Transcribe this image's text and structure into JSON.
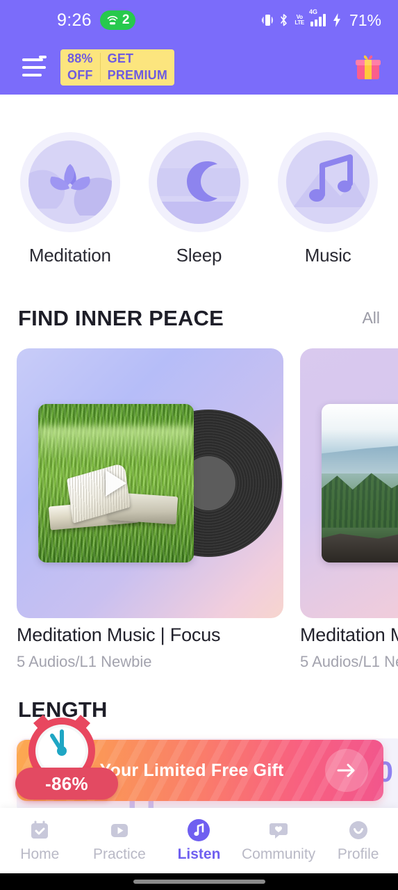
{
  "status_bar": {
    "time": "9:26",
    "hotspot_count": "2",
    "battery": "71%",
    "volte_top": "Vo",
    "volte_bottom": "LTE",
    "network": "4G",
    "icons": [
      "vibrate-icon",
      "bluetooth-icon",
      "volte-icon",
      "signal-bars-icon",
      "charging-bolt-icon"
    ]
  },
  "app_header": {
    "menu_icon": "hamburger-menu-icon",
    "has_notification_dot": true,
    "promo_discount": "88%",
    "promo_discount_line2": "OFF",
    "promo_action": "GET",
    "promo_action_line2": "PREMIUM",
    "gift_icon": "gift-box-icon",
    "background_color": "#7B6CFA",
    "promo_background": "#FCE57E",
    "promo_text_color": "#6E5BE0"
  },
  "categories": [
    {
      "label": "Meditation",
      "icon": "lotus-icon"
    },
    {
      "label": "Sleep",
      "icon": "crescent-moon-icon"
    },
    {
      "label": "Music",
      "icon": "music-note-icon"
    }
  ],
  "sections": {
    "find_inner_peace": {
      "title": "FIND INNER PEACE",
      "all_label": "All",
      "cards": [
        {
          "title": "Meditation Music | Focus",
          "subtitle": "5 Audios/L1 Newbie",
          "artwork": "books-in-grass-with-vinyl-record",
          "play_icon": "play-triangle-icon"
        },
        {
          "title": "Meditation M",
          "subtitle": "5 Audios/L1 Ne",
          "artwork": "person-meditating-on-cliff"
        }
      ]
    },
    "length": {
      "title": "LENGTH",
      "ghost_number": "20",
      "ghost_number_2": "11"
    }
  },
  "gift_banner": {
    "text": "Your Limited Free Gift",
    "discount": "-86%",
    "arrow_icon": "arrow-right-icon",
    "clock_icon": "alarm-clock-icon",
    "gradient_start": "#FCA851",
    "gradient_end": "#F2568C",
    "discount_pill_color": "#E34A62"
  },
  "bottom_nav": {
    "active": "Listen",
    "items": [
      {
        "label": "Home",
        "icon": "calendar-check-icon"
      },
      {
        "label": "Practice",
        "icon": "play-square-icon"
      },
      {
        "label": "Listen",
        "icon": "music-note-icon"
      },
      {
        "label": "Community",
        "icon": "chat-heart-icon"
      },
      {
        "label": "Profile",
        "icon": "smiley-face-icon"
      }
    ],
    "active_color": "#6F5FF0",
    "inactive_color": "#B9B9C6"
  }
}
